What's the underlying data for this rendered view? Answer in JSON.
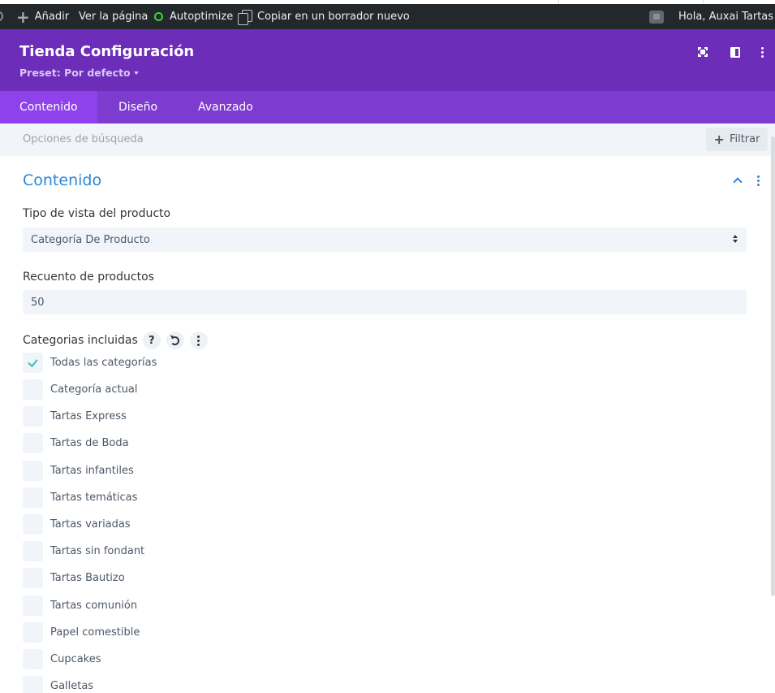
{
  "admin_bar": {
    "add_label": "Añadir",
    "view_page_label": "Ver la página",
    "autoptimize_label": "Autoptimize",
    "copy_draft_label": "Copiar en un borrador nuevo",
    "greeting": "Hola, Auxai Tartas"
  },
  "modal": {
    "title": "Tienda Configuración",
    "preset_label": "Preset: Por defecto"
  },
  "tabs": [
    {
      "label": "Contenido",
      "active": true
    },
    {
      "label": "Diseño",
      "active": false
    },
    {
      "label": "Avanzado",
      "active": false
    }
  ],
  "search": {
    "placeholder": "Opciones de búsqueda",
    "filter_label": "Filtrar"
  },
  "section": {
    "title": "Contenido"
  },
  "fields": {
    "view_type_label": "Tipo de vista del producto",
    "view_type_value": "Categoría De Producto",
    "product_count_label": "Recuento de productos",
    "product_count_value": "50",
    "categories_label": "Categorias incluidas",
    "help_glyph": "?"
  },
  "categories": [
    {
      "label": "Todas las categorías",
      "checked": true
    },
    {
      "label": "Categoría actual",
      "checked": false
    },
    {
      "label": "Tartas Express",
      "checked": false
    },
    {
      "label": "Tartas de Boda",
      "checked": false
    },
    {
      "label": "Tartas infantiles",
      "checked": false
    },
    {
      "label": "Tartas temáticas",
      "checked": false
    },
    {
      "label": "Tartas variadas",
      "checked": false
    },
    {
      "label": "Tartas sin fondant",
      "checked": false
    },
    {
      "label": "Tartas Bautizo",
      "checked": false
    },
    {
      "label": "Tartas comunión",
      "checked": false
    },
    {
      "label": "Papel comestible",
      "checked": false
    },
    {
      "label": "Cupcakes",
      "checked": false
    },
    {
      "label": "Galletas",
      "checked": false
    }
  ],
  "colors": {
    "header_purple": "#6c2eb9",
    "tab_bar_purple": "#7d3bcf",
    "active_tab_purple": "#8f42ec",
    "accent_blue": "#2b87da",
    "check_teal": "#2ec4b6",
    "admin_bar": "#23282d"
  }
}
